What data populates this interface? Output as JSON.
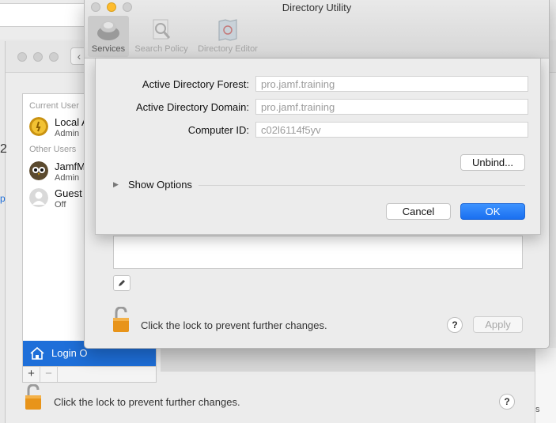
{
  "directory_utility": {
    "title": "Directory Utility",
    "toolbar": [
      {
        "label": "Services",
        "icon": "services-icon",
        "selected": true
      },
      {
        "label": "Search Policy",
        "icon": "search-policy-icon",
        "selected": false
      },
      {
        "label": "Directory Editor",
        "icon": "directory-editor-icon",
        "selected": false
      }
    ],
    "sheet": {
      "fields": [
        {
          "label": "Active Directory Forest:",
          "value": "pro.jamf.training"
        },
        {
          "label": "Active Directory Domain:",
          "value": "pro.jamf.training"
        },
        {
          "label": "Computer ID:",
          "value": "c02l6114f5yv"
        }
      ],
      "unbind_label": "Unbind...",
      "show_options_label": "Show Options",
      "cancel_label": "Cancel",
      "ok_label": "OK"
    },
    "lock_text": "Click the lock to prevent further changes.",
    "help_label": "?",
    "apply_label": "Apply"
  },
  "users_window": {
    "edge_text": "2",
    "edge_text2": "p",
    "sections": {
      "current": "Current User",
      "other": "Other Users"
    },
    "users": [
      {
        "name": "Local A",
        "role": "Admin"
      },
      {
        "name": "JamfM",
        "role": "Admin"
      },
      {
        "name": "Guest",
        "role": "Off"
      }
    ],
    "login_options_label": "Login O",
    "add_label": "+",
    "remove_label": "−",
    "lock_text": "Click the lock to prevent further changes.",
    "help_label": "?",
    "back_label": "‹",
    "right_edge_text": "s"
  },
  "colors": {
    "accent": "#1e6fd9",
    "close": "#fe5f57",
    "minimize": "#febc2e",
    "zoom": "#d0d0d0"
  }
}
